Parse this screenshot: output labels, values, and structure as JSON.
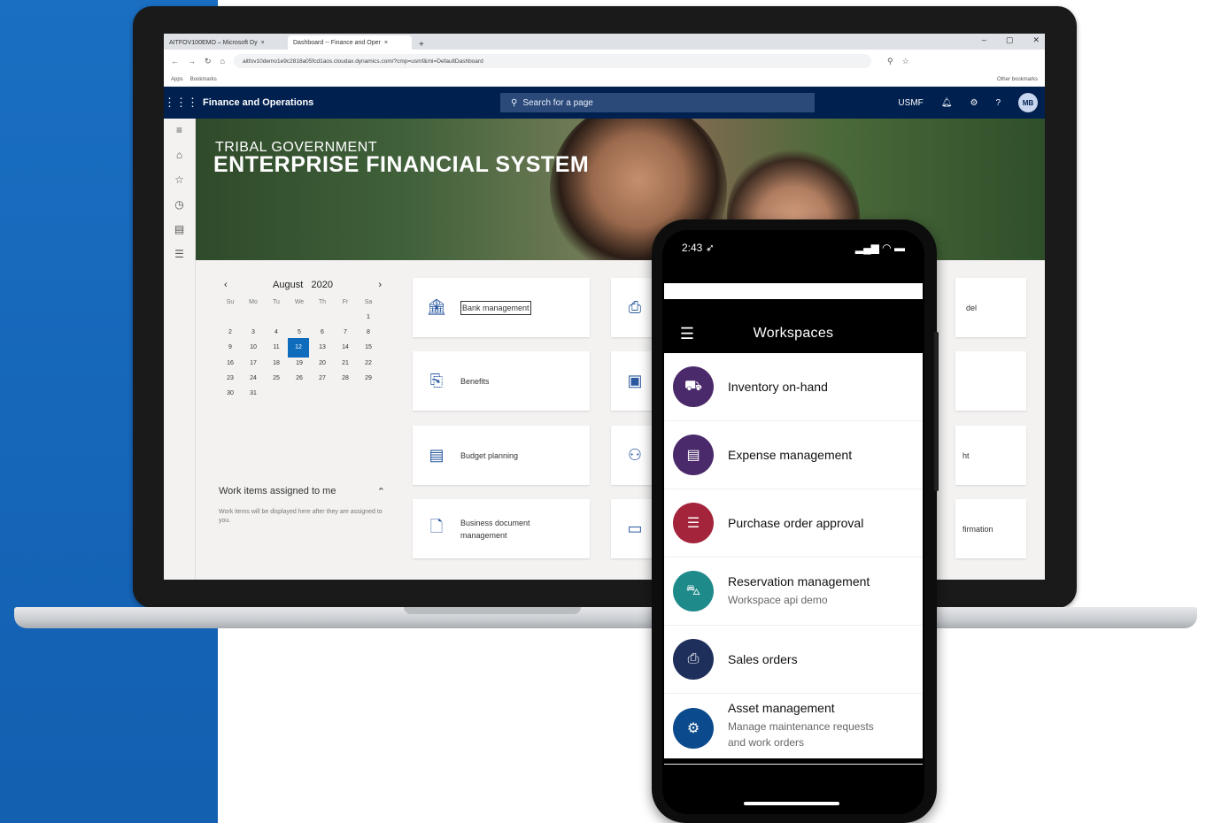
{
  "browser": {
    "tabs": [
      {
        "label": "AITFOV100EMO – Microsoft Dy",
        "close": "×"
      },
      {
        "label": "Dashboard -- Finance and Oper",
        "close": "×"
      }
    ],
    "new_tab": "+",
    "window_controls": [
      "–",
      "▢",
      "✕"
    ],
    "url": "aitfov10demo1e9c2818a05fcd1aos.cloudax.dynamics.com/?cmp=usmf&mi=DefaultDashboard",
    "bookmarks": {
      "apps": "Apps",
      "bookmarks": "Bookmarks",
      "other": "Other bookmarks"
    }
  },
  "app": {
    "title": "Finance and Operations",
    "search_placeholder": "Search for a page",
    "company": "USMF",
    "user_initials": "MB"
  },
  "banner": {
    "line1": "TRIBAL GOVERNMENT",
    "line2": "ENTERPRISE FINANCIAL SYSTEM"
  },
  "calendar": {
    "month": "August",
    "year": "2020",
    "prev": "‹",
    "next": "›",
    "weekdays": [
      "Su",
      "Mo",
      "Tu",
      "We",
      "Th",
      "Fr",
      "Sa"
    ],
    "weeks": [
      [
        "",
        "",
        "",
        "",
        "",
        "",
        "1"
      ],
      [
        "2",
        "3",
        "4",
        "5",
        "6",
        "7",
        "8"
      ],
      [
        "9",
        "10",
        "11",
        "12",
        "13",
        "14",
        "15"
      ],
      [
        "16",
        "17",
        "18",
        "19",
        "20",
        "21",
        "22"
      ],
      [
        "23",
        "24",
        "25",
        "26",
        "27",
        "28",
        "29"
      ],
      [
        "30",
        "31",
        "",
        "",
        "",
        "",
        ""
      ]
    ],
    "selected": "12"
  },
  "work_items": {
    "title": "Work items assigned to me",
    "note": "Work items will be displayed here after they are assigned to you."
  },
  "tiles": [
    {
      "label": "Bank management",
      "icon": "bank-icon"
    },
    {
      "label": "Benefits",
      "icon": "benefits-icon"
    },
    {
      "label": "Budget planning",
      "icon": "budget-icon"
    },
    {
      "label": "Business document management",
      "icon": "document-icon"
    }
  ],
  "tiles_partial_right": [
    "del",
    "ht",
    "firmation"
  ],
  "phone": {
    "time": "2:43",
    "header_title": "Workspaces",
    "items": [
      {
        "title": "Inventory on-hand",
        "subtitle": "",
        "color": "#4b2a6b",
        "icon": "inventory-icon"
      },
      {
        "title": "Expense management",
        "subtitle": "",
        "color": "#4b2a6b",
        "icon": "expense-icon"
      },
      {
        "title": "Purchase order approval",
        "subtitle": "",
        "color": "#a3243b",
        "icon": "purchase-icon"
      },
      {
        "title": "Reservation management",
        "subtitle": "Workspace api demo",
        "color": "#1f8a8a",
        "icon": "reservation-icon"
      },
      {
        "title": "Sales orders",
        "subtitle": "",
        "color": "#1f2f5c",
        "icon": "sales-icon"
      },
      {
        "title": "Asset management",
        "subtitle": "Manage maintenance requests and work orders",
        "color": "#0b4a8c",
        "icon": "asset-icon"
      }
    ]
  },
  "colors": {
    "nav": "#002050",
    "accent": "#0f6cbd",
    "side_panel": "#1565b8"
  }
}
